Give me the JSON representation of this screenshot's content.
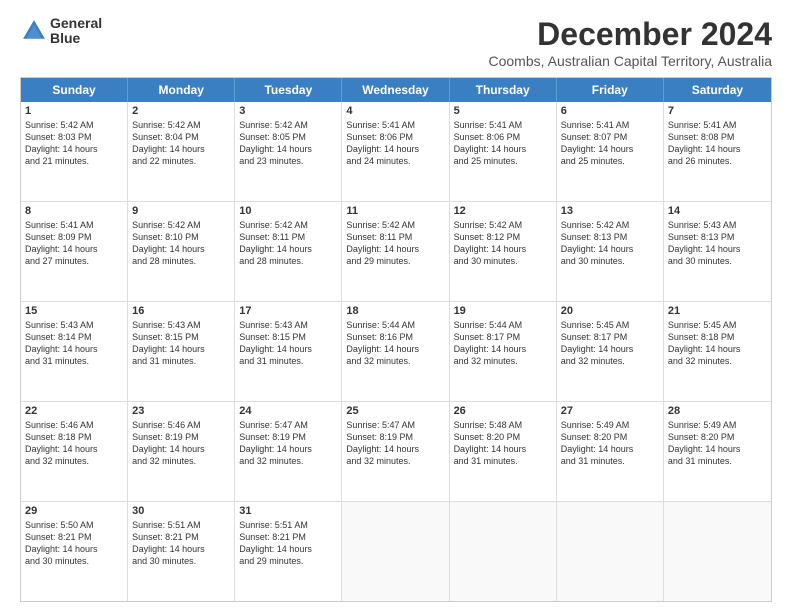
{
  "logo": {
    "line1": "General",
    "line2": "Blue"
  },
  "title": "December 2024",
  "location": "Coombs, Australian Capital Territory, Australia",
  "days_header": [
    "Sunday",
    "Monday",
    "Tuesday",
    "Wednesday",
    "Thursday",
    "Friday",
    "Saturday"
  ],
  "weeks": [
    [
      {
        "day": "1",
        "lines": [
          "Sunrise: 5:42 AM",
          "Sunset: 8:03 PM",
          "Daylight: 14 hours",
          "and 21 minutes."
        ]
      },
      {
        "day": "2",
        "lines": [
          "Sunrise: 5:42 AM",
          "Sunset: 8:04 PM",
          "Daylight: 14 hours",
          "and 22 minutes."
        ]
      },
      {
        "day": "3",
        "lines": [
          "Sunrise: 5:42 AM",
          "Sunset: 8:05 PM",
          "Daylight: 14 hours",
          "and 23 minutes."
        ]
      },
      {
        "day": "4",
        "lines": [
          "Sunrise: 5:41 AM",
          "Sunset: 8:06 PM",
          "Daylight: 14 hours",
          "and 24 minutes."
        ]
      },
      {
        "day": "5",
        "lines": [
          "Sunrise: 5:41 AM",
          "Sunset: 8:06 PM",
          "Daylight: 14 hours",
          "and 25 minutes."
        ]
      },
      {
        "day": "6",
        "lines": [
          "Sunrise: 5:41 AM",
          "Sunset: 8:07 PM",
          "Daylight: 14 hours",
          "and 25 minutes."
        ]
      },
      {
        "day": "7",
        "lines": [
          "Sunrise: 5:41 AM",
          "Sunset: 8:08 PM",
          "Daylight: 14 hours",
          "and 26 minutes."
        ]
      }
    ],
    [
      {
        "day": "8",
        "lines": [
          "Sunrise: 5:41 AM",
          "Sunset: 8:09 PM",
          "Daylight: 14 hours",
          "and 27 minutes."
        ]
      },
      {
        "day": "9",
        "lines": [
          "Sunrise: 5:42 AM",
          "Sunset: 8:10 PM",
          "Daylight: 14 hours",
          "and 28 minutes."
        ]
      },
      {
        "day": "10",
        "lines": [
          "Sunrise: 5:42 AM",
          "Sunset: 8:11 PM",
          "Daylight: 14 hours",
          "and 28 minutes."
        ]
      },
      {
        "day": "11",
        "lines": [
          "Sunrise: 5:42 AM",
          "Sunset: 8:11 PM",
          "Daylight: 14 hours",
          "and 29 minutes."
        ]
      },
      {
        "day": "12",
        "lines": [
          "Sunrise: 5:42 AM",
          "Sunset: 8:12 PM",
          "Daylight: 14 hours",
          "and 30 minutes."
        ]
      },
      {
        "day": "13",
        "lines": [
          "Sunrise: 5:42 AM",
          "Sunset: 8:13 PM",
          "Daylight: 14 hours",
          "and 30 minutes."
        ]
      },
      {
        "day": "14",
        "lines": [
          "Sunrise: 5:43 AM",
          "Sunset: 8:13 PM",
          "Daylight: 14 hours",
          "and 30 minutes."
        ]
      }
    ],
    [
      {
        "day": "15",
        "lines": [
          "Sunrise: 5:43 AM",
          "Sunset: 8:14 PM",
          "Daylight: 14 hours",
          "and 31 minutes."
        ]
      },
      {
        "day": "16",
        "lines": [
          "Sunrise: 5:43 AM",
          "Sunset: 8:15 PM",
          "Daylight: 14 hours",
          "and 31 minutes."
        ]
      },
      {
        "day": "17",
        "lines": [
          "Sunrise: 5:43 AM",
          "Sunset: 8:15 PM",
          "Daylight: 14 hours",
          "and 31 minutes."
        ]
      },
      {
        "day": "18",
        "lines": [
          "Sunrise: 5:44 AM",
          "Sunset: 8:16 PM",
          "Daylight: 14 hours",
          "and 32 minutes."
        ]
      },
      {
        "day": "19",
        "lines": [
          "Sunrise: 5:44 AM",
          "Sunset: 8:17 PM",
          "Daylight: 14 hours",
          "and 32 minutes."
        ]
      },
      {
        "day": "20",
        "lines": [
          "Sunrise: 5:45 AM",
          "Sunset: 8:17 PM",
          "Daylight: 14 hours",
          "and 32 minutes."
        ]
      },
      {
        "day": "21",
        "lines": [
          "Sunrise: 5:45 AM",
          "Sunset: 8:18 PM",
          "Daylight: 14 hours",
          "and 32 minutes."
        ]
      }
    ],
    [
      {
        "day": "22",
        "lines": [
          "Sunrise: 5:46 AM",
          "Sunset: 8:18 PM",
          "Daylight: 14 hours",
          "and 32 minutes."
        ]
      },
      {
        "day": "23",
        "lines": [
          "Sunrise: 5:46 AM",
          "Sunset: 8:19 PM",
          "Daylight: 14 hours",
          "and 32 minutes."
        ]
      },
      {
        "day": "24",
        "lines": [
          "Sunrise: 5:47 AM",
          "Sunset: 8:19 PM",
          "Daylight: 14 hours",
          "and 32 minutes."
        ]
      },
      {
        "day": "25",
        "lines": [
          "Sunrise: 5:47 AM",
          "Sunset: 8:19 PM",
          "Daylight: 14 hours",
          "and 32 minutes."
        ]
      },
      {
        "day": "26",
        "lines": [
          "Sunrise: 5:48 AM",
          "Sunset: 8:20 PM",
          "Daylight: 14 hours",
          "and 31 minutes."
        ]
      },
      {
        "day": "27",
        "lines": [
          "Sunrise: 5:49 AM",
          "Sunset: 8:20 PM",
          "Daylight: 14 hours",
          "and 31 minutes."
        ]
      },
      {
        "day": "28",
        "lines": [
          "Sunrise: 5:49 AM",
          "Sunset: 8:20 PM",
          "Daylight: 14 hours",
          "and 31 minutes."
        ]
      }
    ],
    [
      {
        "day": "29",
        "lines": [
          "Sunrise: 5:50 AM",
          "Sunset: 8:21 PM",
          "Daylight: 14 hours",
          "and 30 minutes."
        ]
      },
      {
        "day": "30",
        "lines": [
          "Sunrise: 5:51 AM",
          "Sunset: 8:21 PM",
          "Daylight: 14 hours",
          "and 30 minutes."
        ]
      },
      {
        "day": "31",
        "lines": [
          "Sunrise: 5:51 AM",
          "Sunset: 8:21 PM",
          "Daylight: 14 hours",
          "and 29 minutes."
        ]
      },
      {
        "day": "",
        "lines": []
      },
      {
        "day": "",
        "lines": []
      },
      {
        "day": "",
        "lines": []
      },
      {
        "day": "",
        "lines": []
      }
    ]
  ]
}
